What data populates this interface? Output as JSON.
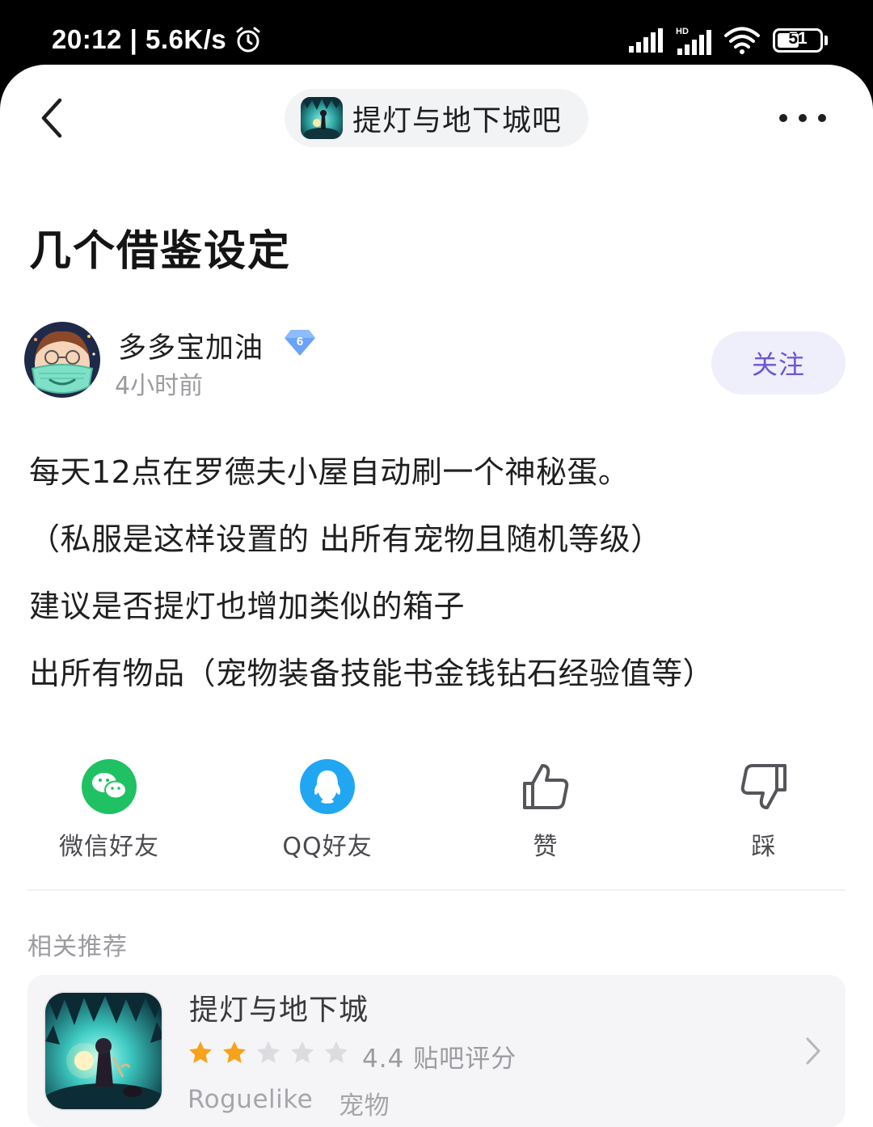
{
  "status_bar": {
    "time": "20:12",
    "net_speed": "5.6K/s",
    "battery": "51",
    "icons": [
      "alarm-icon",
      "signal-icon",
      "hd-signal-icon",
      "wifi-icon",
      "battery-icon"
    ]
  },
  "header": {
    "forum_name": "提灯与地下城吧",
    "back_icon": "chevron-left-icon",
    "more_icon": "more-dots-icon"
  },
  "post": {
    "title": "几个借鉴设定",
    "author": "多多宝加油",
    "level": "6",
    "time": "4小时前",
    "follow_label": "关注",
    "lines": [
      "每天12点在罗德夫小屋自动刷一个神秘蛋。",
      "（私服是这样设置的 出所有宠物且随机等级）",
      "建议是否提灯也增加类似的箱子",
      "出所有物品（宠物装备技能书金钱钻石经验值等）"
    ]
  },
  "actions": {
    "wechat": "微信好友",
    "qq": "QQ好友",
    "like": "赞",
    "dislike": "踩"
  },
  "recommend": {
    "section_title": "相关推荐",
    "game_name": "提灯与地下城",
    "rating": 2,
    "rating_max": 5,
    "score": "4.4 贴吧评分",
    "tags": [
      "Roguelike",
      "宠物"
    ]
  },
  "colors": {
    "accent": "#6c55d4",
    "follow_bg": "#efeefb",
    "wechat": "#1fc162",
    "qq": "#21a6f2",
    "star_on": "#f7a21b",
    "star_off": "#dcdce0"
  }
}
